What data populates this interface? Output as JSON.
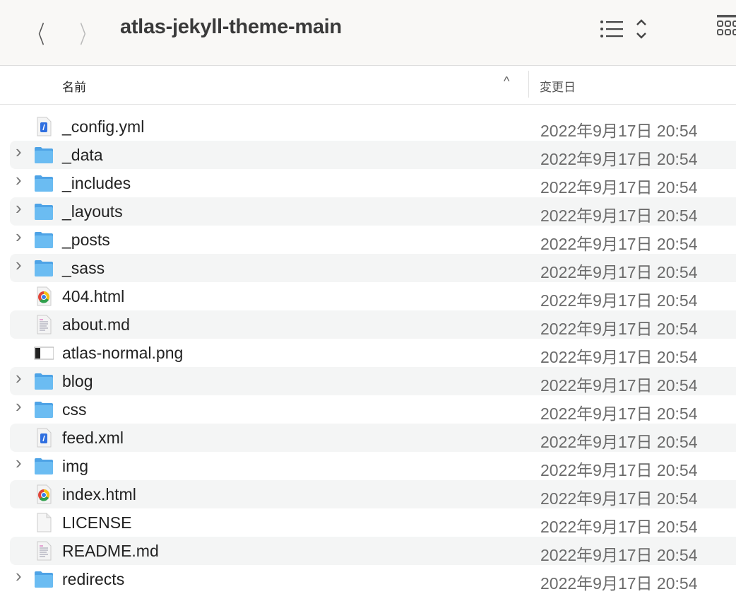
{
  "window": {
    "title": "atlas-jekyll-theme-main",
    "back": "〈",
    "forward": "〉"
  },
  "columns": {
    "name": "名前",
    "sort_indicator": "^",
    "date": "変更日"
  },
  "files": [
    {
      "name": "_config.yml",
      "type": "yml",
      "folder": false,
      "date": "2022年9月17日 20:54"
    },
    {
      "name": "_data",
      "type": "folder",
      "folder": true,
      "date": "2022年9月17日 20:54"
    },
    {
      "name": "_includes",
      "type": "folder",
      "folder": true,
      "date": "2022年9月17日 20:54"
    },
    {
      "name": "_layouts",
      "type": "folder",
      "folder": true,
      "date": "2022年9月17日 20:54"
    },
    {
      "name": "_posts",
      "type": "folder",
      "folder": true,
      "date": "2022年9月17日 20:54"
    },
    {
      "name": "_sass",
      "type": "folder",
      "folder": true,
      "date": "2022年9月17日 20:54"
    },
    {
      "name": "404.html",
      "type": "html",
      "folder": false,
      "date": "2022年9月17日 20:54"
    },
    {
      "name": "about.md",
      "type": "md",
      "folder": false,
      "date": "2022年9月17日 20:54"
    },
    {
      "name": "atlas-normal.png",
      "type": "png",
      "folder": false,
      "date": "2022年9月17日 20:54"
    },
    {
      "name": "blog",
      "type": "folder",
      "folder": true,
      "date": "2022年9月17日 20:54"
    },
    {
      "name": "css",
      "type": "folder",
      "folder": true,
      "date": "2022年9月17日 20:54"
    },
    {
      "name": "feed.xml",
      "type": "yml",
      "folder": false,
      "date": "2022年9月17日 20:54"
    },
    {
      "name": "img",
      "type": "folder",
      "folder": true,
      "date": "2022年9月17日 20:54"
    },
    {
      "name": "index.html",
      "type": "html",
      "folder": false,
      "date": "2022年9月17日 20:54"
    },
    {
      "name": "LICENSE",
      "type": "generic",
      "folder": false,
      "date": "2022年9月17日 20:54"
    },
    {
      "name": "README.md",
      "type": "md",
      "folder": false,
      "date": "2022年9月17日 20:54"
    },
    {
      "name": "redirects",
      "type": "folder",
      "folder": true,
      "date": "2022年9月17日 20:54"
    }
  ],
  "colors": {
    "folder": "#5fb0ec",
    "accent": "#2f6fe0"
  }
}
